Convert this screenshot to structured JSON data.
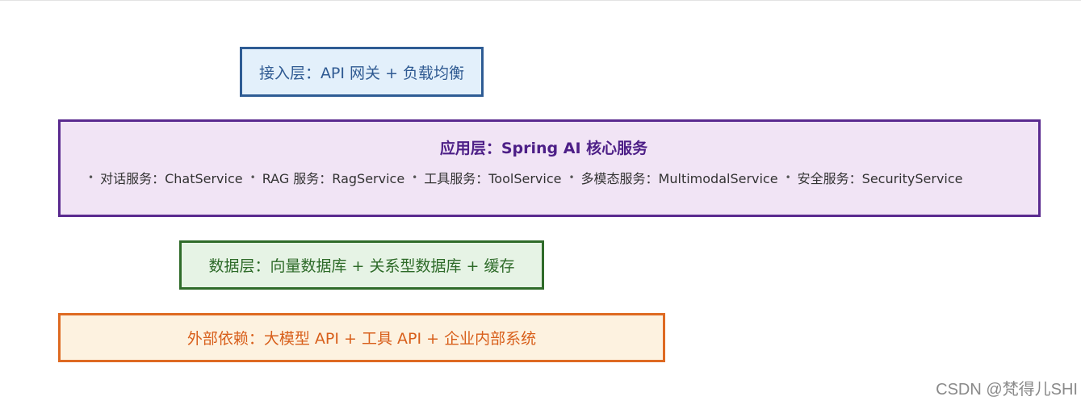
{
  "layers": {
    "access": {
      "text": "接入层：API 网关 + 负载均衡"
    },
    "application": {
      "title": "应用层：Spring AI 核心服务",
      "services": [
        {
          "label": "对话服务：ChatService"
        },
        {
          "label": "RAG 服务：RagService"
        },
        {
          "label": "工具服务：ToolService"
        },
        {
          "label": "多模态服务：MultimodalService"
        },
        {
          "label": "安全服务：SecurityService"
        }
      ],
      "bullet": "•"
    },
    "data": {
      "text": "数据层：向量数据库 + 关系型数据库 + 缓存"
    },
    "external": {
      "text": "外部依赖：大模型 API + 工具 API + 企业内部系统"
    }
  },
  "watermark": "CSDN @梵得儿SHI",
  "colors": {
    "access_border": "#2e5c94",
    "access_fill": "#e3f0fb",
    "application_border": "#5a2a8f",
    "application_fill": "#f1e4f5",
    "data_border": "#2f6b2a",
    "data_fill": "#e6f3e5",
    "external_border": "#de6a22",
    "external_fill": "#fdf2e0"
  }
}
